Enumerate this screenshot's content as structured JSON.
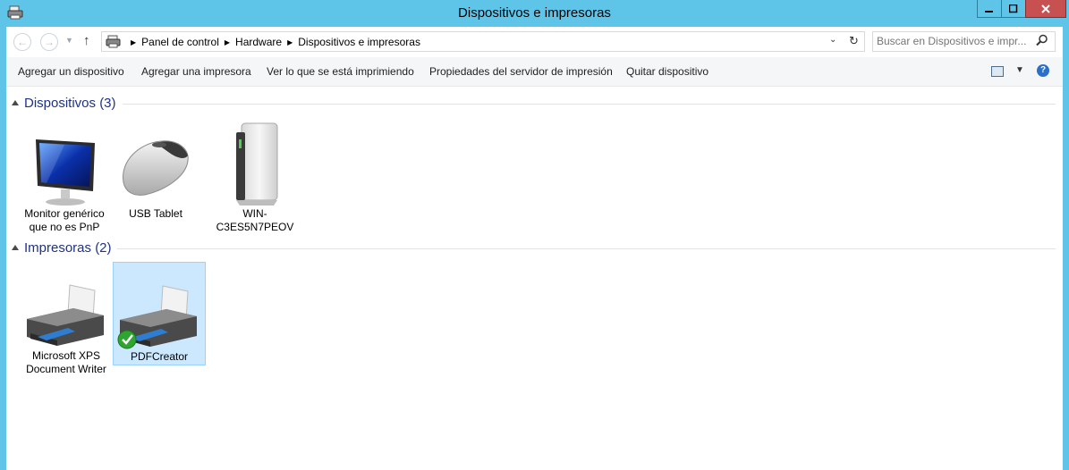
{
  "window": {
    "title": "Dispositivos e impresoras"
  },
  "navigation": {
    "back_label": "←",
    "forward_label": "→",
    "up_label": "↑",
    "breadcrumbs": [
      "Panel de control",
      "Hardware",
      "Dispositivos e impresoras"
    ],
    "search_placeholder": "Buscar en Dispositivos e impr..."
  },
  "commands": [
    "Agregar un dispositivo",
    "Agregar una impresora",
    "Ver lo que se está imprimiendo",
    "Propiedades del servidor de impresión",
    "Quitar dispositivo"
  ],
  "groups": {
    "devices": {
      "title": "Dispositivos (3)",
      "items": [
        {
          "label": "Monitor genérico que no es PnP",
          "icon": "monitor-icon"
        },
        {
          "label": "USB Tablet",
          "icon": "mouse-icon"
        },
        {
          "label": "WIN-C3ES5N7PEOV",
          "icon": "computer-tower-icon"
        }
      ]
    },
    "printers": {
      "title": "Impresoras (2)",
      "items": [
        {
          "label": "Microsoft XPS Document Writer",
          "icon": "printer-icon",
          "default": false
        },
        {
          "label": "PDFCreator",
          "icon": "printer-icon",
          "default": true,
          "selected": true
        }
      ]
    }
  },
  "colors": {
    "titlebar": "#5ec4e8",
    "group_title": "#1e3287",
    "selection": "#cce8ff",
    "close_button": "#c75050"
  }
}
